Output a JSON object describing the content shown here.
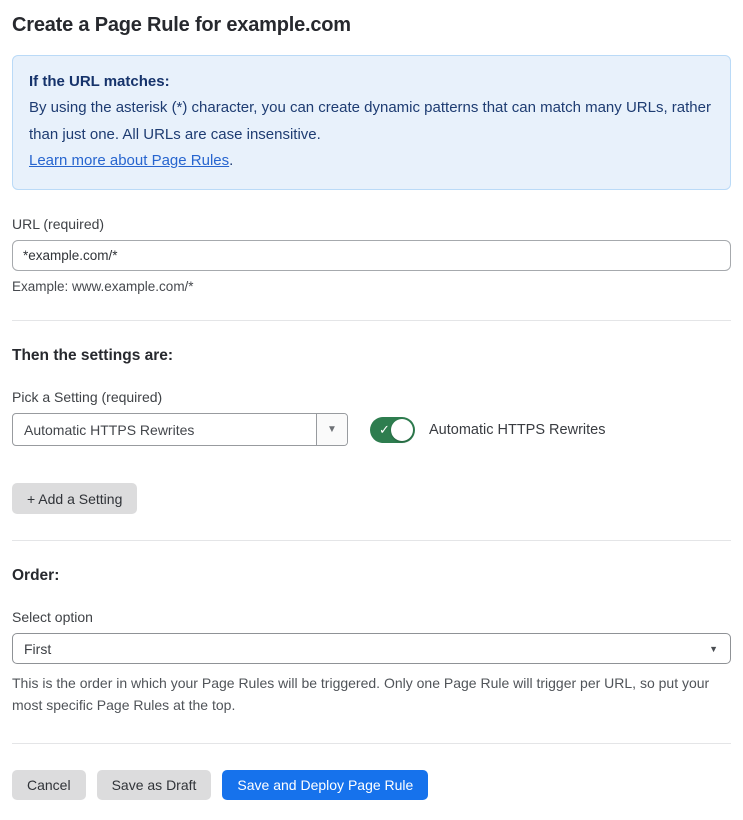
{
  "page": {
    "title": "Create a Page Rule for example.com"
  },
  "info_box": {
    "heading": "If the URL matches:",
    "body": "By using the asterisk (*) character, you can create dynamic patterns that can match many URLs, rather than just one. All URLs are case insensitive.",
    "link": "Learn more about Page Rules",
    "link_suffix": "."
  },
  "url_field": {
    "label": "URL (required)",
    "value": "*example.com/*",
    "helper": "Example: www.example.com/*"
  },
  "settings_section": {
    "heading": "Then the settings are:",
    "picker_label": "Pick a Setting (required)",
    "selected_setting": "Automatic HTTPS Rewrites",
    "toggle_state": "on",
    "toggle_label": "Automatic HTTPS Rewrites",
    "add_setting_label": "+ Add a Setting"
  },
  "order_section": {
    "heading": "Order:",
    "select_label": "Select option",
    "selected_option": "First",
    "helper": "This is the order in which your Page Rules will be triggered. Only one Page Rule will trigger per URL, so put your most specific Page Rules at the top."
  },
  "footer": {
    "cancel_label": "Cancel",
    "save_draft_label": "Save as Draft",
    "save_deploy_label": "Save and Deploy Page Rule"
  },
  "icons": {
    "dropdown_caret": "▼",
    "toggle_check": "✓"
  },
  "colors": {
    "primary_blue": "#1672ec",
    "info_background": "#e8f1fb",
    "info_border": "#badaf7",
    "info_text": "#1e3c72",
    "link_blue": "#2765cf",
    "toggle_green": "#2e7d4f",
    "button_gray": "#dcdcdd"
  }
}
